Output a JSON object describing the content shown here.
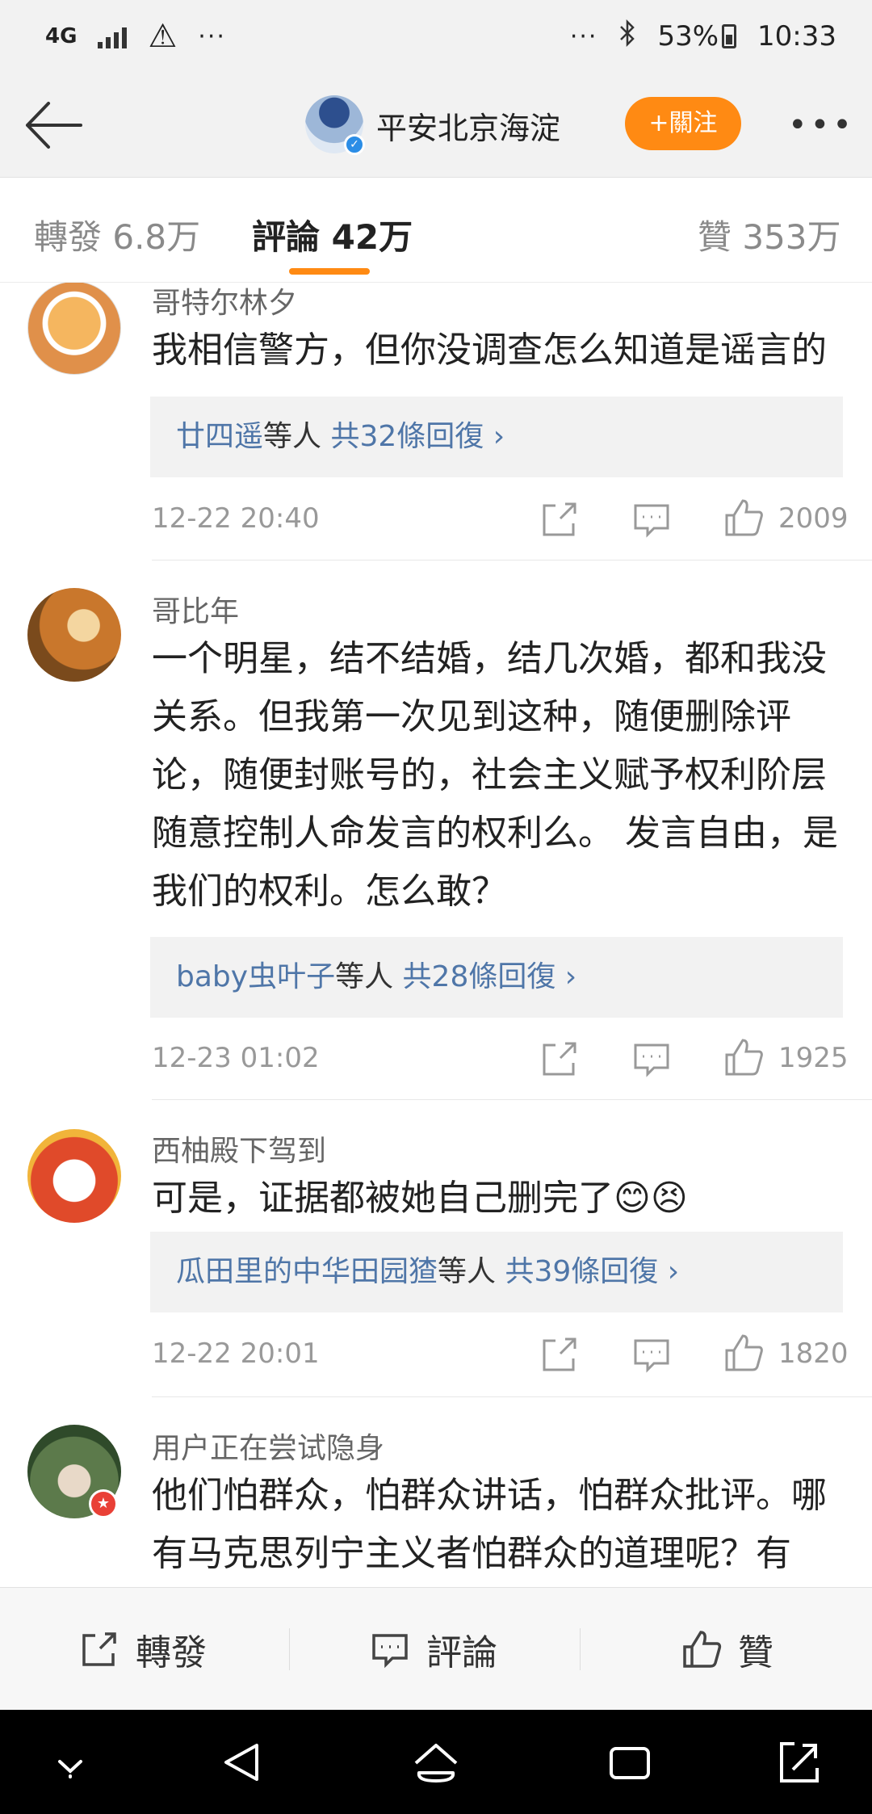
{
  "status_bar": {
    "network": "4G",
    "dots": "···",
    "battery": "53%",
    "time": "10:33",
    "icons": [
      "signal-icon",
      "warning-icon",
      "bluetooth-icon",
      "battery-icon"
    ]
  },
  "header": {
    "account_name": "平安北京海淀",
    "follow_label": "+關注",
    "more_label": "•••"
  },
  "tabs": [
    {
      "label": "轉發 6.8万",
      "active": false
    },
    {
      "label": "評論 42万",
      "active": true
    },
    {
      "label": "贊 353万",
      "active": false
    }
  ],
  "comments": [
    {
      "username": "哥特尔林夕",
      "text": "我相信警方，但你没调查怎么知道是谣言的",
      "replies_users": "廿四遥",
      "replies_suffix": "等人",
      "replies_count": " 共32條回復 ›",
      "timestamp": "12-22 20:40",
      "likes": "2009"
    },
    {
      "username": "哥比年",
      "text": "一个明星，结不结婚，结几次婚，都和我没关系。但我第一次见到这种，随便删除评论，随便封账号的，社会主义赋予权利阶层随意控制人命发言的权利么。 发言自由，是我们的权利。怎么敢？",
      "replies_users": "baby虫叶子",
      "replies_suffix": "等人",
      "replies_count": " 共28條回復 ›",
      "timestamp": "12-23 01:02",
      "likes": "1925"
    },
    {
      "username": "西柚殿下驾到",
      "text": "可是，证据都被她自己删完了😊😣",
      "replies_users": "瓜田里的中华田园猹",
      "replies_suffix": "等人",
      "replies_count": " 共39條回復 ›",
      "timestamp": "12-22 20:01",
      "likes": "1820"
    },
    {
      "username": "用户正在尝试隐身",
      "text": "他们怕群众，怕群众讲话，怕群众批评。哪有马克思列宁主义者怕群众的道理呢？有"
    }
  ],
  "bottom_bar": {
    "repost": "轉發",
    "comment": "評論",
    "like": "贊"
  },
  "colors": {
    "accent": "#ff8a13",
    "link_blue": "#4f76a8",
    "verified": "#2b8de6"
  }
}
